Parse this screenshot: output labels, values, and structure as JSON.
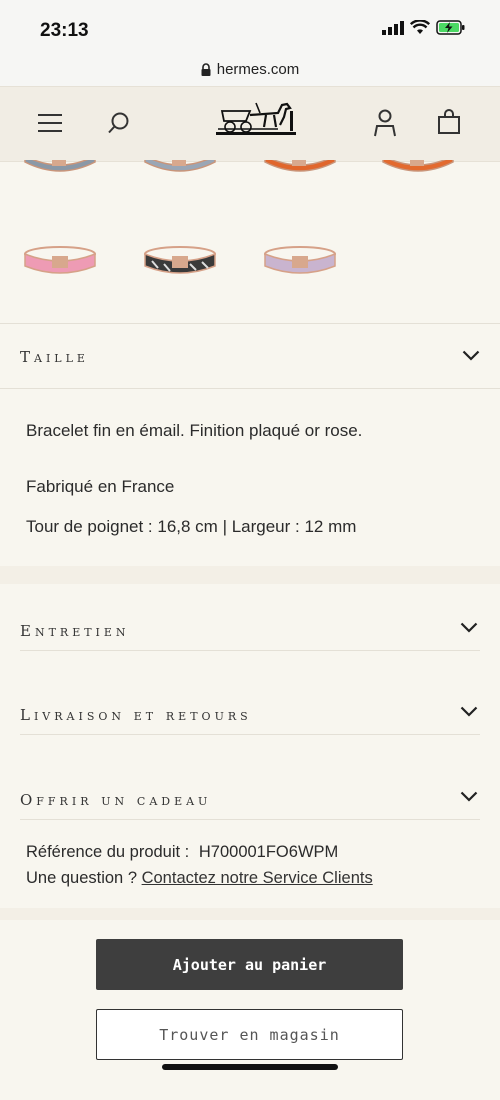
{
  "status": {
    "time": "23:13"
  },
  "browser": {
    "url": "hermes.com"
  },
  "header": {
    "logo_alt": "HERMÈS"
  },
  "accordion": {
    "taille": "Taille",
    "entretien": "Entretien",
    "livraison": "Livraison et retours",
    "cadeau": "Offrir un cadeau"
  },
  "description": {
    "line1": "Bracelet fin en émail. Finition plaqué or rose.",
    "line2": "Fabriqué en France",
    "line3": "Tour de poignet : 16,8 cm | Largeur : 12 mm"
  },
  "reference": {
    "label": "Référence du produit :",
    "value": "H700001FO6WPM",
    "question": "Une question ?",
    "contact_link": "Contactez notre Service Clients"
  },
  "buttons": {
    "add_to_cart": "Ajouter au panier",
    "find_store": "Trouver en magasin"
  },
  "colors": {
    "accent_dark": "#3e3e3e",
    "background": "#f8f6ef"
  }
}
